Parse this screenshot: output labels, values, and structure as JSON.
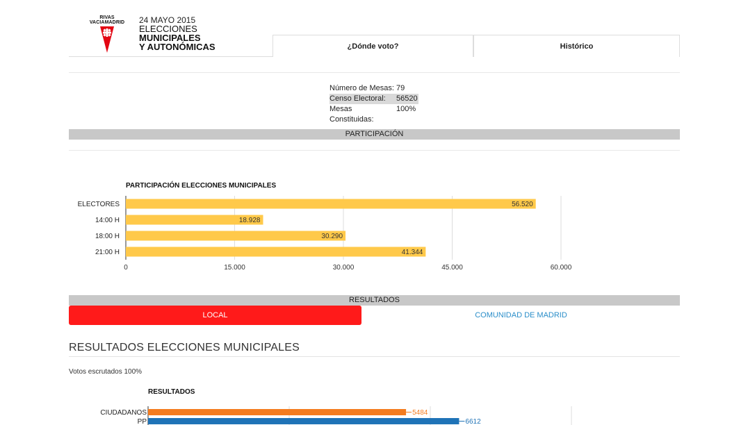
{
  "header": {
    "logo_text_line1": "RIVAS",
    "logo_text_line2": "VACIAMADRID",
    "date": "24 MAYO 2015",
    "title_line1": "ELECCIONES",
    "title_line2": "MUNICIPALES",
    "title_line3": "Y AUTONÓMICAS",
    "tabs": [
      {
        "label": "¿Dónde voto?"
      },
      {
        "label": "Histórico"
      }
    ]
  },
  "stats": [
    {
      "label": "Número de Mesas:",
      "value": "79"
    },
    {
      "label": "Censo Electoral:",
      "value": "56520"
    },
    {
      "label": "Mesas Constituidas:",
      "value": "100%"
    }
  ],
  "sections": {
    "participacion": "PARTICIPACIÓN",
    "resultados": "RESULTADOS"
  },
  "participation_chart": {
    "title": "PARTICIPACIÓN ELECCIONES MUNICIPALES",
    "bar_color": "#ffc94a",
    "categories": [
      "ELECTORES",
      "14:00 H",
      "18:00 H",
      "21:00 H"
    ],
    "values": [
      56520,
      18928,
      30290,
      41344
    ],
    "value_labels": [
      "56.520",
      "18.928",
      "30.290",
      "41.344"
    ],
    "xlim": [
      0,
      60000
    ],
    "ticks": [
      0,
      15000,
      30000,
      45000,
      60000
    ],
    "tick_labels": [
      "0",
      "15.000",
      "30.000",
      "45.000",
      "60.000"
    ]
  },
  "results_tabs": {
    "local": "LOCAL",
    "comunidad": "COMUNIDAD DE MADRID",
    "active_color": "#ff1a1a",
    "link_color": "#2a8ec9"
  },
  "results": {
    "heading": "RESULTADOS ELECCIONES MUNICIPALES",
    "escrutado": "Votos escrutados 100%",
    "chart_title": "RESULTADOS"
  },
  "chart_data": {
    "type": "bar",
    "title": "RESULTADOS",
    "categories": [
      "CIUDADANOS",
      "PP"
    ],
    "values": [
      5484,
      6612
    ],
    "colors": [
      "#f47c20",
      "#1f73b7"
    ],
    "xlim": [
      0,
      12000
    ]
  }
}
